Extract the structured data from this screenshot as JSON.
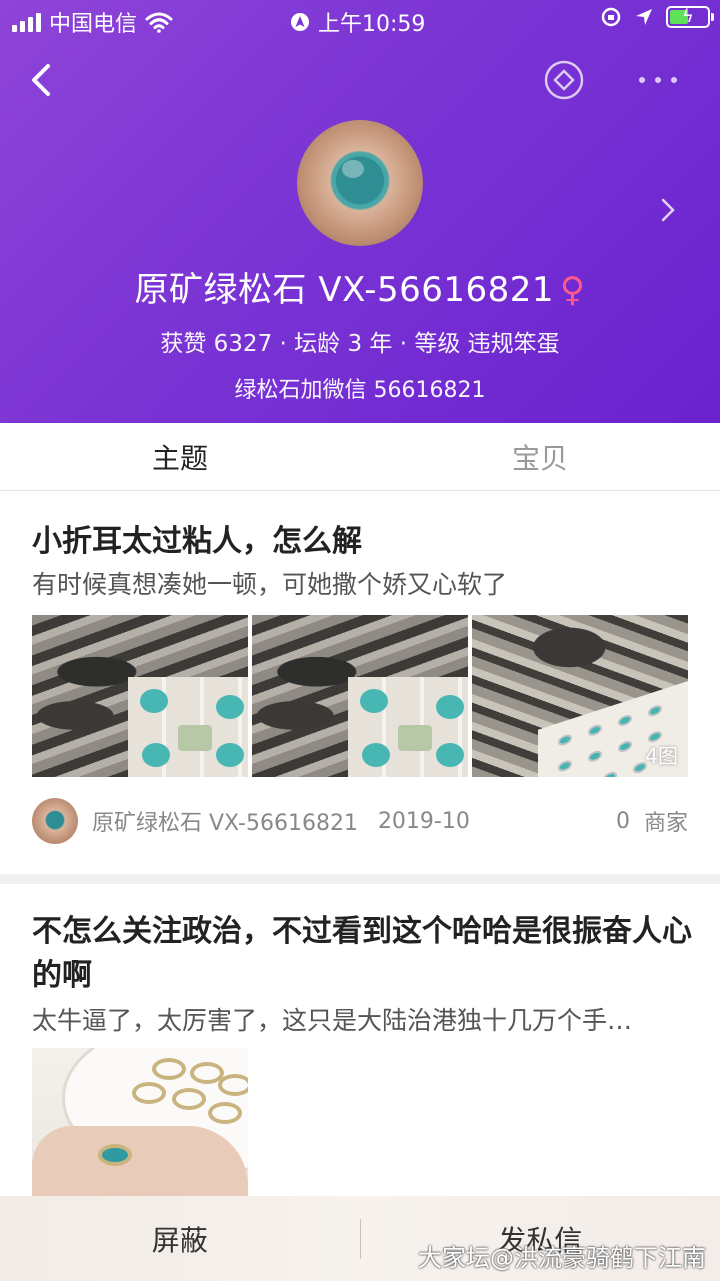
{
  "status_bar": {
    "carrier": "中国电信",
    "time": "上午10:59"
  },
  "profile": {
    "name": "原矿绿松石 VX-56616821",
    "gender_symbol": "♀",
    "stats": "获赞 6327 · 坛龄 3 年 · 等级 违规笨蛋",
    "bio": "绿松石加微信 56616821"
  },
  "tabs": [
    {
      "label": "主题",
      "active": true
    },
    {
      "label": "宝贝",
      "active": false
    }
  ],
  "posts": [
    {
      "title": "小折耳太过粘人，怎么解",
      "subtitle": "有时候真想凑她一顿，可她撒个娇又心软了",
      "image_count_badge": "4图",
      "author": "原矿绿松石 VX-56616821",
      "date": "2019-10",
      "replies": "0",
      "category": "商家"
    },
    {
      "title": "不怎么关注政治，不过看到这个哈哈是很振奋人心的啊",
      "subtitle": "太牛逼了，太厉害了，这只是大陆治港独十几万个手…"
    }
  ],
  "bottom_bar": {
    "block_label": "屏蔽",
    "message_label": "发私信"
  },
  "watermark": "大家坛@洪流豪骑鹤下江南",
  "colors": {
    "header_gradient_start": "#8f44d8",
    "header_gradient_end": "#6a22cf",
    "female_symbol": "#ff5a8a"
  }
}
